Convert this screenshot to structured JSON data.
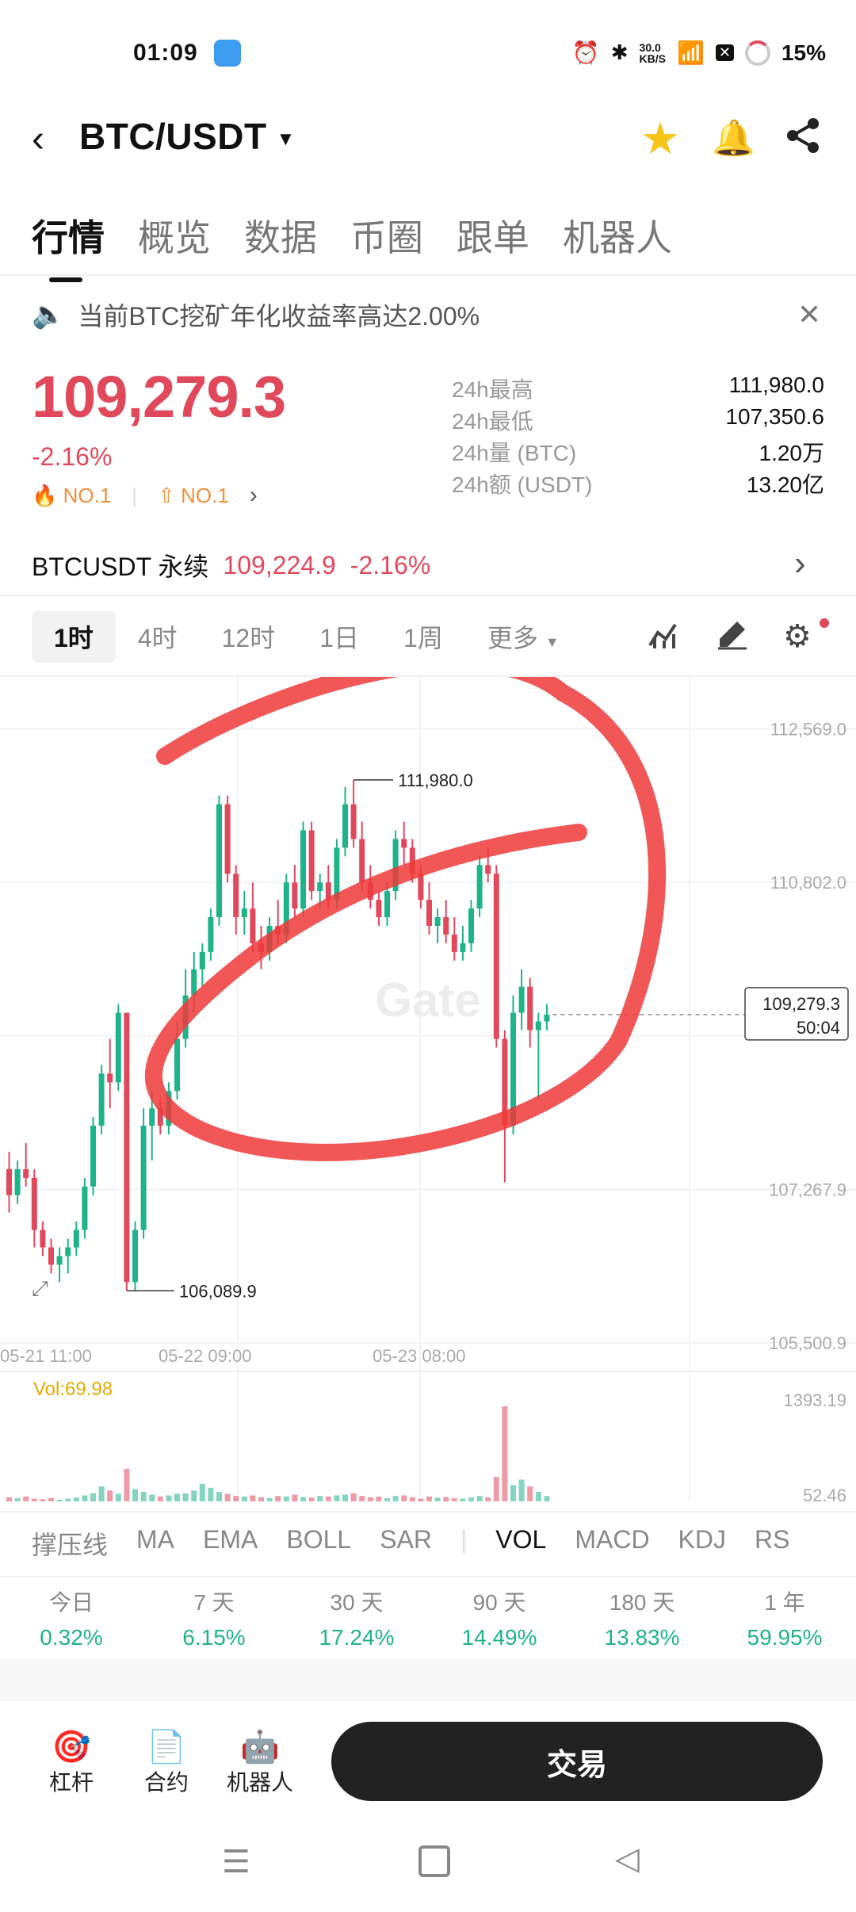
{
  "status": {
    "time": "01:09",
    "net_speed_value": "30.0",
    "net_speed_unit": "KB/S",
    "battery": "15%"
  },
  "header": {
    "pair": "BTC/USDT"
  },
  "tabs": [
    "行情",
    "概览",
    "数据",
    "币圈",
    "跟单",
    "机器人"
  ],
  "notice": "当前BTC挖矿年化收益率高达2.00%",
  "price": {
    "last": "109,279.3",
    "change": "-2.16%",
    "rank1": "NO.1",
    "rank2": "NO.1"
  },
  "stats": [
    {
      "k": "24h最高",
      "v": "111,980.0"
    },
    {
      "k": "24h最低",
      "v": "107,350.6"
    },
    {
      "k": "24h量 (BTC)",
      "v": "1.20万"
    },
    {
      "k": "24h额 (USDT)",
      "v": "13.20亿"
    }
  ],
  "perp": {
    "name": "BTCUSDT 永续",
    "price": "109,224.9",
    "change": "-2.16%"
  },
  "timeframes": [
    "1时",
    "4时",
    "12时",
    "1日",
    "1周",
    "更多"
  ],
  "chart": {
    "y_ticks": [
      "112,569.0",
      "110,802.0",
      "107,267.9",
      "105,500.9"
    ],
    "x_ticks": [
      "05-21 11:00",
      "05-22 09:00",
      "05-23 08:00"
    ],
    "high_label": "111,980.0",
    "low_label": "106,089.9",
    "current_price": "109,279.3",
    "countdown": "50:04",
    "vol_label": "Vol:69.98",
    "vol_ticks": [
      "1393.19",
      "52.46"
    ],
    "watermark": "Gate"
  },
  "chart_data": {
    "type": "candlestick",
    "ylim": [
      105500.9,
      112800
    ],
    "candles": [
      [
        107500,
        107700,
        107000,
        107200
      ],
      [
        107200,
        107600,
        107100,
        107500
      ],
      [
        107500,
        107800,
        107300,
        107400
      ],
      [
        107400,
        107500,
        106600,
        106800
      ],
      [
        106800,
        106900,
        106500,
        106600
      ],
      [
        106600,
        106700,
        106300,
        106400
      ],
      [
        106400,
        106600,
        106200,
        106500
      ],
      [
        106500,
        106700,
        106300,
        106600
      ],
      [
        106600,
        106900,
        106500,
        106800
      ],
      [
        106800,
        107400,
        106700,
        107300
      ],
      [
        107300,
        108100,
        107200,
        108000
      ],
      [
        108000,
        108700,
        107900,
        108600
      ],
      [
        108600,
        109000,
        108200,
        108500
      ],
      [
        108500,
        109400,
        108400,
        109300
      ],
      [
        109300,
        109200,
        106100,
        106200
      ],
      [
        106200,
        106900,
        106100,
        106800
      ],
      [
        106800,
        108200,
        106700,
        108000
      ],
      [
        108000,
        108400,
        107600,
        108200
      ],
      [
        108200,
        108300,
        107900,
        108000
      ],
      [
        108000,
        108500,
        107900,
        108400
      ],
      [
        108400,
        109200,
        108300,
        109000
      ],
      [
        109000,
        109800,
        108900,
        109500
      ],
      [
        109500,
        110000,
        109300,
        109800
      ],
      [
        109800,
        110100,
        109600,
        110000
      ],
      [
        110000,
        110500,
        109900,
        110400
      ],
      [
        110400,
        111800,
        110300,
        111700
      ],
      [
        111700,
        111800,
        110800,
        110900
      ],
      [
        110900,
        111000,
        110200,
        110400
      ],
      [
        110400,
        110700,
        110200,
        110500
      ],
      [
        110500,
        110800,
        110000,
        110100
      ],
      [
        110100,
        110300,
        109800,
        110000
      ],
      [
        110000,
        110400,
        109900,
        110300
      ],
      [
        110300,
        110600,
        110100,
        110200
      ],
      [
        110200,
        110900,
        110100,
        110800
      ],
      [
        110800,
        111000,
        110400,
        110500
      ],
      [
        110500,
        111500,
        110400,
        111400
      ],
      [
        111400,
        111500,
        110600,
        110700
      ],
      [
        110700,
        110900,
        110500,
        110800
      ],
      [
        110800,
        111000,
        110500,
        110600
      ],
      [
        110600,
        111300,
        110500,
        111200
      ],
      [
        111200,
        111900,
        111100,
        111700
      ],
      [
        111700,
        111980,
        111200,
        111300
      ],
      [
        111300,
        111500,
        110700,
        110800
      ],
      [
        110800,
        111000,
        110500,
        110600
      ],
      [
        110600,
        110700,
        110300,
        110400
      ],
      [
        110400,
        110800,
        110300,
        110700
      ],
      [
        110700,
        111400,
        110600,
        111300
      ],
      [
        111300,
        111500,
        111000,
        111200
      ],
      [
        111200,
        111300,
        110800,
        110900
      ],
      [
        110900,
        111000,
        110500,
        110600
      ],
      [
        110600,
        110800,
        110200,
        110300
      ],
      [
        110300,
        110500,
        110100,
        110400
      ],
      [
        110400,
        110600,
        110100,
        110200
      ],
      [
        110200,
        110400,
        109900,
        110000
      ],
      [
        110000,
        110300,
        109900,
        110100
      ],
      [
        110100,
        110600,
        110000,
        110500
      ],
      [
        110500,
        111100,
        110400,
        111000
      ],
      [
        111000,
        111200,
        110800,
        110900
      ],
      [
        110900,
        111000,
        108900,
        109000
      ],
      [
        109000,
        109100,
        107350,
        108000
      ],
      [
        108000,
        109500,
        107900,
        109300
      ],
      [
        109300,
        109800,
        109100,
        109600
      ],
      [
        109600,
        109700,
        108900,
        109100
      ],
      [
        109100,
        109300,
        108300,
        109200
      ],
      [
        109200,
        109400,
        109100,
        109279
      ]
    ],
    "volumes": [
      15,
      12,
      18,
      10,
      8,
      12,
      6,
      10,
      14,
      22,
      30,
      55,
      40,
      28,
      120,
      45,
      35,
      25,
      18,
      22,
      28,
      30,
      40,
      65,
      50,
      35,
      28,
      20,
      18,
      22,
      15,
      12,
      20,
      18,
      25,
      16,
      14,
      20,
      18,
      22,
      25,
      30,
      20,
      15,
      18,
      12,
      20,
      22,
      15,
      10,
      18,
      14,
      16,
      12,
      10,
      14,
      20,
      15,
      90,
      350,
      60,
      80,
      55,
      35,
      20
    ]
  },
  "indicators": [
    "撑压线",
    "MA",
    "EMA",
    "BOLL",
    "SAR",
    "VOL",
    "MACD",
    "KDJ",
    "RS"
  ],
  "performance": [
    {
      "label": "今日",
      "value": "0.32%"
    },
    {
      "label": "7 天",
      "value": "6.15%"
    },
    {
      "label": "30 天",
      "value": "17.24%"
    },
    {
      "label": "90 天",
      "value": "14.49%"
    },
    {
      "label": "180 天",
      "value": "13.83%"
    },
    {
      "label": "1 年",
      "value": "59.95%"
    }
  ],
  "bottom": {
    "items": [
      "杠杆",
      "合约",
      "机器人"
    ],
    "trade": "交易"
  },
  "colors": {
    "up": "#1fb38a",
    "down": "#e0495c",
    "accent": "#f5c518",
    "annotation": "#ee3a3a"
  }
}
